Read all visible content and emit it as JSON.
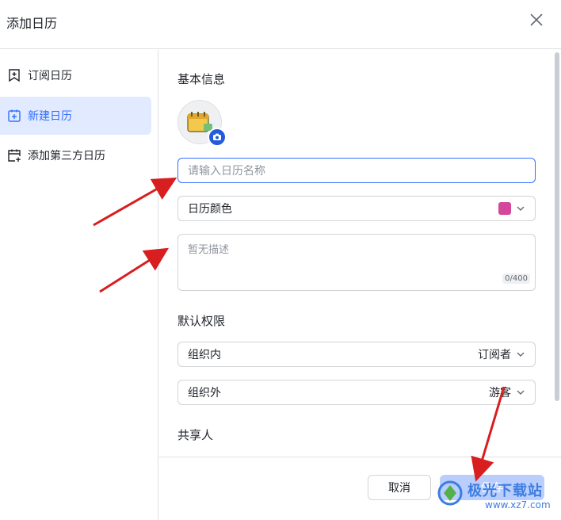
{
  "dialog": {
    "title": "添加日历"
  },
  "sidebar": {
    "items": [
      {
        "label": "订阅日历",
        "icon": "bookmark-add-icon",
        "active": false
      },
      {
        "label": "新建日历",
        "icon": "calendar-plus-icon",
        "active": true
      },
      {
        "label": "添加第三方日历",
        "icon": "calendar-add-icon",
        "active": false
      }
    ]
  },
  "basic": {
    "title": "基本信息",
    "name_placeholder": "请输入日历名称",
    "color_label": "日历颜色",
    "color_value": "#d4489c",
    "desc_placeholder": "暂无描述",
    "desc_counter": "0/400"
  },
  "permissions": {
    "title": "默认权限",
    "rows": [
      {
        "label": "组织内",
        "value": "订阅者"
      },
      {
        "label": "组织外",
        "value": "游客"
      }
    ]
  },
  "sharing": {
    "title": "共享人"
  },
  "footer": {
    "cancel": "取消",
    "save": "保存"
  },
  "watermark": {
    "text": "极光下载站",
    "url": "www.xz7.com"
  },
  "colors": {
    "accent": "#3370ff",
    "arrow": "#d81e1e"
  }
}
